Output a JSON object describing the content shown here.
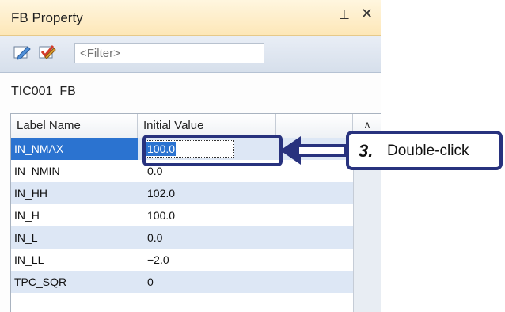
{
  "window": {
    "title": "FB Property",
    "pin_icon": "pin-icon",
    "close_icon": "close-icon"
  },
  "toolbar": {
    "buttons": [
      "edit-pencil-icon",
      "edit-check-icon"
    ],
    "filter_placeholder": "<Filter>"
  },
  "fb_name": "TIC001_FB",
  "table": {
    "headers": [
      "Label Name",
      "Initial Value",
      ""
    ],
    "rows": [
      {
        "label": "IN_NMAX",
        "value": "100.0",
        "selected": true
      },
      {
        "label": "IN_NMIN",
        "value": "0.0"
      },
      {
        "label": "IN_HH",
        "value": "102.0"
      },
      {
        "label": "IN_H",
        "value": "100.0"
      },
      {
        "label": "IN_L",
        "value": "0.0"
      },
      {
        "label": "IN_LL",
        "value": "−2.0"
      },
      {
        "label": "TPC_SQR",
        "value": "0"
      }
    ]
  },
  "callout": {
    "step": "3.",
    "text": "Double-click"
  },
  "colors": {
    "selection": "#2b73d0",
    "alt_row": "#dde7f5",
    "annotation": "#28327e",
    "title_bar": "#fde7b8"
  }
}
